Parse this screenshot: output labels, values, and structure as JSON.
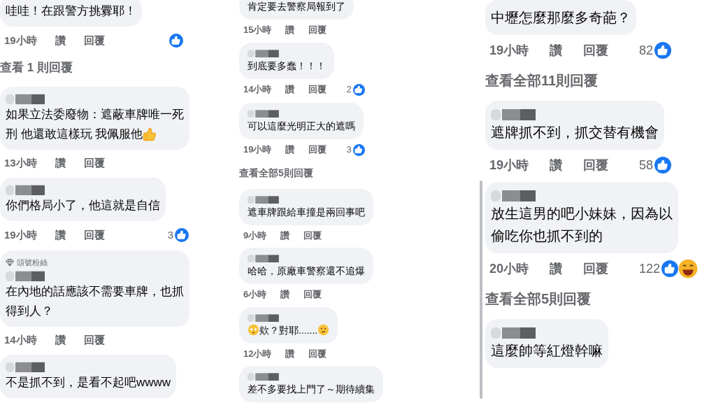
{
  "columns": [
    {
      "items": [
        {
          "kind": "comment",
          "lines": [
            "哇哇！在跟警方挑釁耶！"
          ],
          "time": "19小時",
          "like": "讚",
          "reply": "回覆",
          "like_reaction": true
        },
        {
          "kind": "more",
          "label": "查看 1 則回覆"
        },
        {
          "kind": "comment",
          "name_redacted": true,
          "lines": [
            "如果立法委廢物：遮蔽車牌唯一死",
            "刑 他還敢這樣玩 我佩服他"
          ],
          "thumbs_emoji": true,
          "time": "13小時",
          "like": "讚",
          "reply": "回覆"
        },
        {
          "kind": "comment",
          "name_redacted": true,
          "lines": [
            "你們格局小了，他這就是自信"
          ],
          "time": "19小時",
          "like": "讚",
          "reply": "回覆",
          "count": "3",
          "like_reaction": true
        },
        {
          "kind": "comment",
          "badge": "頭號粉絲",
          "name_redacted": true,
          "lines": [
            "在內地的話應該不需要車牌，也抓",
            "得到人？"
          ],
          "time": "14小時",
          "like": "讚",
          "reply": "回覆"
        },
        {
          "kind": "comment",
          "name_redacted": true,
          "lines": [
            "不是抓不到，是看不起吧wwww"
          ]
        }
      ]
    },
    {
      "items": [
        {
          "kind": "comment",
          "lines": [
            "肯定要去警察局報到了"
          ],
          "time": "15小時",
          "like": "讚",
          "reply": "回覆"
        },
        {
          "kind": "comment",
          "name_redacted": true,
          "lines": [
            "到底要多蠢！！！"
          ],
          "time": "14小時",
          "like": "讚",
          "reply": "回覆",
          "count": "2",
          "like_reaction": true
        },
        {
          "kind": "comment",
          "name_redacted": true,
          "lines": [
            "可以這麼光明正大的遮嗎"
          ],
          "time": "19小時",
          "like": "讚",
          "reply": "回覆",
          "count": "3",
          "like_reaction": true
        },
        {
          "kind": "more",
          "label": "查看全部5則回覆"
        },
        {
          "kind": "comment",
          "name_redacted": true,
          "lines": [
            "遮車牌跟給車撞是兩回事吧"
          ],
          "time": "9小時",
          "like": "讚",
          "reply": "回覆"
        },
        {
          "kind": "comment",
          "name_redacted": true,
          "lines": [
            "哈哈，原廠車警察還不追爆"
          ],
          "time": "6小時",
          "like": "讚",
          "reply": "回覆"
        },
        {
          "kind": "comment",
          "name_redacted": true,
          "flushed_emoji": true,
          "lines": [
            "欸？對耶......."
          ],
          "thinking_emoji": true,
          "time": "12小時",
          "like": "讚",
          "reply": "回覆"
        },
        {
          "kind": "comment",
          "name_redacted": true,
          "lines": [
            "差不多要找上門了～期待續集"
          ]
        }
      ]
    },
    {
      "items": [
        {
          "kind": "comment",
          "lines": [
            "中壢怎麼那麼多奇葩？"
          ],
          "time": "19小時",
          "like": "讚",
          "reply": "回覆",
          "count": "82",
          "like_reaction": true
        },
        {
          "kind": "more",
          "label": "查看全部11則回覆"
        },
        {
          "kind": "comment",
          "name_redacted": true,
          "lines": [
            "遮牌抓不到，抓交替有機會"
          ],
          "time": "19小時",
          "like": "讚",
          "reply": "回覆",
          "count": "58",
          "like_reaction": true
        },
        {
          "kind": "comment",
          "name_redacted": true,
          "lines": [
            "放生這男的吧小妹妹，因為以",
            "偷吃你也抓不到的"
          ],
          "time": "20小時",
          "like": "讚",
          "reply": "回覆",
          "count": "122",
          "like_reaction": true,
          "haha_reaction": true
        },
        {
          "kind": "more",
          "label": "查看全部5則回覆"
        },
        {
          "kind": "comment",
          "name_redacted": true,
          "lines": [
            "這麼帥等紅燈幹嘛"
          ]
        }
      ]
    }
  ]
}
